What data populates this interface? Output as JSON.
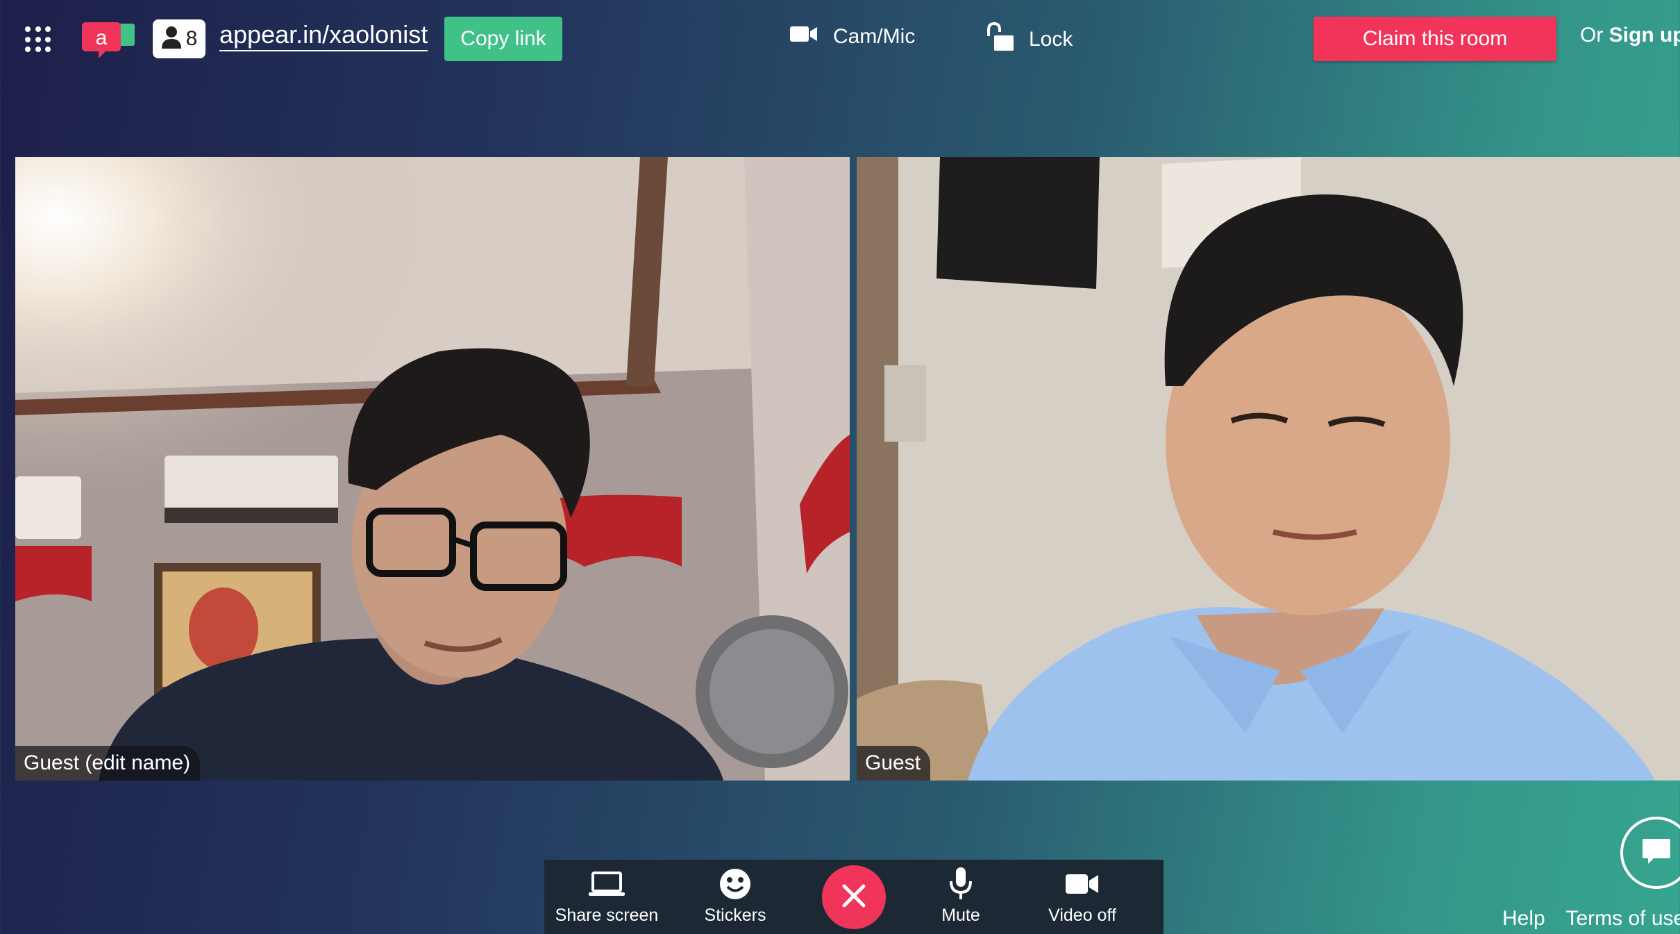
{
  "header": {
    "participant_count": "8",
    "room_url": "appear.in/xaolonist",
    "copy_link_label": "Copy link",
    "cam_mic_label": "Cam/Mic",
    "lock_label": "Lock",
    "claim_label": "Claim this room",
    "signup_prefix": "Or",
    "signup_label": "Sign up"
  },
  "videos": [
    {
      "name_label": "Guest (edit name)"
    },
    {
      "name_label": "Guest"
    }
  ],
  "toolbar": {
    "share_screen_label": "Share screen",
    "stickers_label": "Stickers",
    "mute_label": "Mute",
    "video_off_label": "Video off"
  },
  "footer": {
    "help_label": "Help",
    "terms_label": "Terms of use"
  },
  "colors": {
    "accent_pink": "#f1345a",
    "accent_green": "#3fc188",
    "toolbar_bg": "#1c2935"
  },
  "icons": [
    "apps-grid-icon",
    "appear-in-logo",
    "person-icon",
    "video-camera-icon",
    "unlock-icon",
    "laptop-icon",
    "smiley-icon",
    "close-icon",
    "microphone-icon",
    "chat-bubble-icon"
  ]
}
